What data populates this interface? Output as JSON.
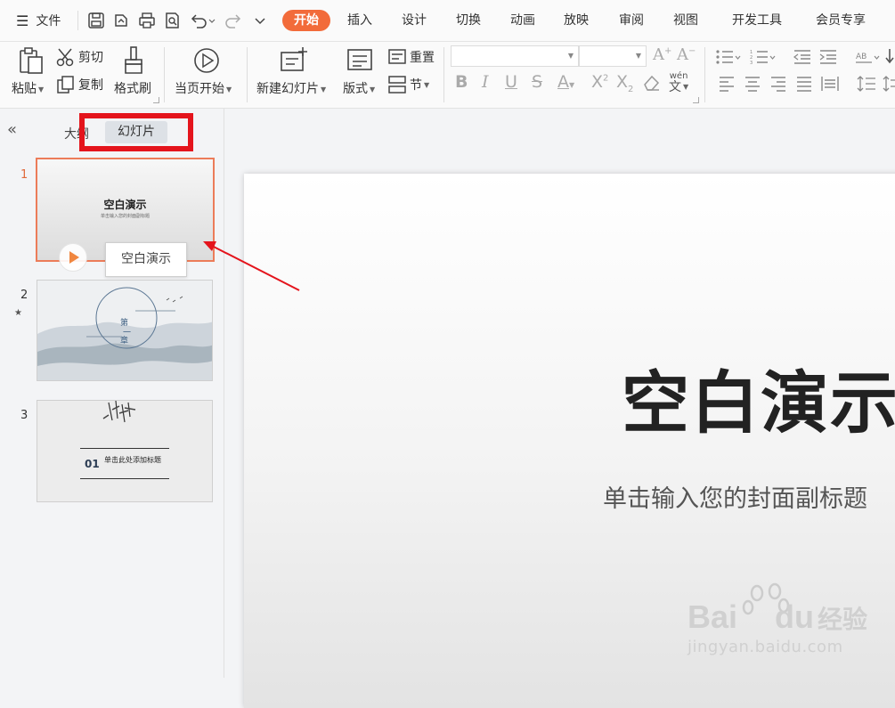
{
  "menubar": {
    "file_label": "文件",
    "tabs": [
      "开始",
      "插入",
      "设计",
      "切换",
      "动画",
      "放映",
      "审阅",
      "视图",
      "开发工具",
      "会员专享"
    ],
    "active_tab": "开始"
  },
  "ribbon": {
    "paste": "粘贴",
    "cut": "剪切",
    "copy": "复制",
    "format_painter": "格式刷",
    "from_current": "当页开始",
    "new_slide": "新建幻灯片",
    "layout": "版式",
    "reset": "重置",
    "section": "节",
    "phonetic": "wén"
  },
  "left_pane": {
    "outline_tab": "大纲",
    "slides_tab": "幻灯片",
    "tooltip": "空白演示",
    "slides": [
      {
        "number": "1",
        "title": "空白演示",
        "subtitle": "单击输入您的封面副标题"
      },
      {
        "number": "2",
        "text_a": "第",
        "text_b": "一",
        "text_c": "章"
      },
      {
        "number": "3",
        "num_label": "01",
        "title": "单击此处添加标题"
      }
    ]
  },
  "canvas": {
    "title": "空白演示",
    "subtitle": "单击输入您的封面副标题"
  },
  "watermark": {
    "brand": "Bai",
    "brand2": "du",
    "cn": "经验",
    "url": "jingyan.baidu.com"
  },
  "colors": {
    "accent": "#f26b3a",
    "annotation_red": "#e4141c",
    "selected_thumb_border": "#ec7c59"
  }
}
